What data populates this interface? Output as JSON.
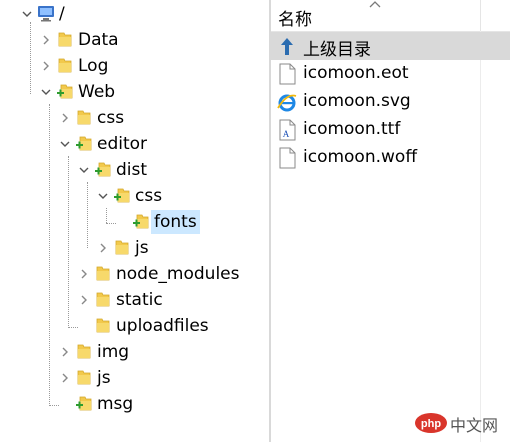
{
  "tree": {
    "items": [
      {
        "label": "/",
        "depth": 0,
        "expander": "v",
        "icon": "computer-icon"
      },
      {
        "label": "Data",
        "depth": 1,
        "expander": ">",
        "icon": "folder-icon"
      },
      {
        "label": "Log",
        "depth": 1,
        "expander": ">",
        "icon": "folder-icon"
      },
      {
        "label": "Web",
        "depth": 1,
        "expander": "v",
        "icon": "folder-plus-icon"
      },
      {
        "label": "css",
        "depth": 2,
        "expander": ">",
        "icon": "folder-icon"
      },
      {
        "label": "editor",
        "depth": 2,
        "expander": "v",
        "icon": "folder-plus-icon"
      },
      {
        "label": "dist",
        "depth": 3,
        "expander": "v",
        "icon": "folder-plus-icon"
      },
      {
        "label": "css",
        "depth": 4,
        "expander": "v",
        "icon": "folder-plus-icon"
      },
      {
        "label": "fonts",
        "depth": 5,
        "expander": "",
        "icon": "folder-plus-icon",
        "selected": true
      },
      {
        "label": "js",
        "depth": 4,
        "expander": ">",
        "icon": "folder-icon"
      },
      {
        "label": "node_modules",
        "depth": 3,
        "expander": ">",
        "icon": "folder-icon"
      },
      {
        "label": "static",
        "depth": 3,
        "expander": ">",
        "icon": "folder-icon"
      },
      {
        "label": "uploadfiles",
        "depth": 3,
        "expander": "",
        "icon": "folder-icon"
      },
      {
        "label": "img",
        "depth": 2,
        "expander": ">",
        "icon": "folder-icon"
      },
      {
        "label": "js",
        "depth": 2,
        "expander": ">",
        "icon": "folder-icon"
      },
      {
        "label": "msg",
        "depth": 2,
        "expander": "",
        "icon": "folder-plus-icon"
      }
    ]
  },
  "list": {
    "header": "名称",
    "up_label": "上级目录",
    "files": [
      {
        "name": "icomoon.eot",
        "icon": "blank-file-icon"
      },
      {
        "name": "icomoon.svg",
        "icon": "ie-file-icon"
      },
      {
        "name": "icomoon.ttf",
        "icon": "font-file-icon"
      },
      {
        "name": "icomoon.woff",
        "icon": "blank-file-icon"
      }
    ]
  },
  "watermark": {
    "logo": "php",
    "text": "中文网"
  },
  "colors": {
    "selection": "#cce8ff",
    "up_row": "#d9d9d9",
    "folder": "#f2c94c",
    "plus": "#2e9c2e"
  }
}
